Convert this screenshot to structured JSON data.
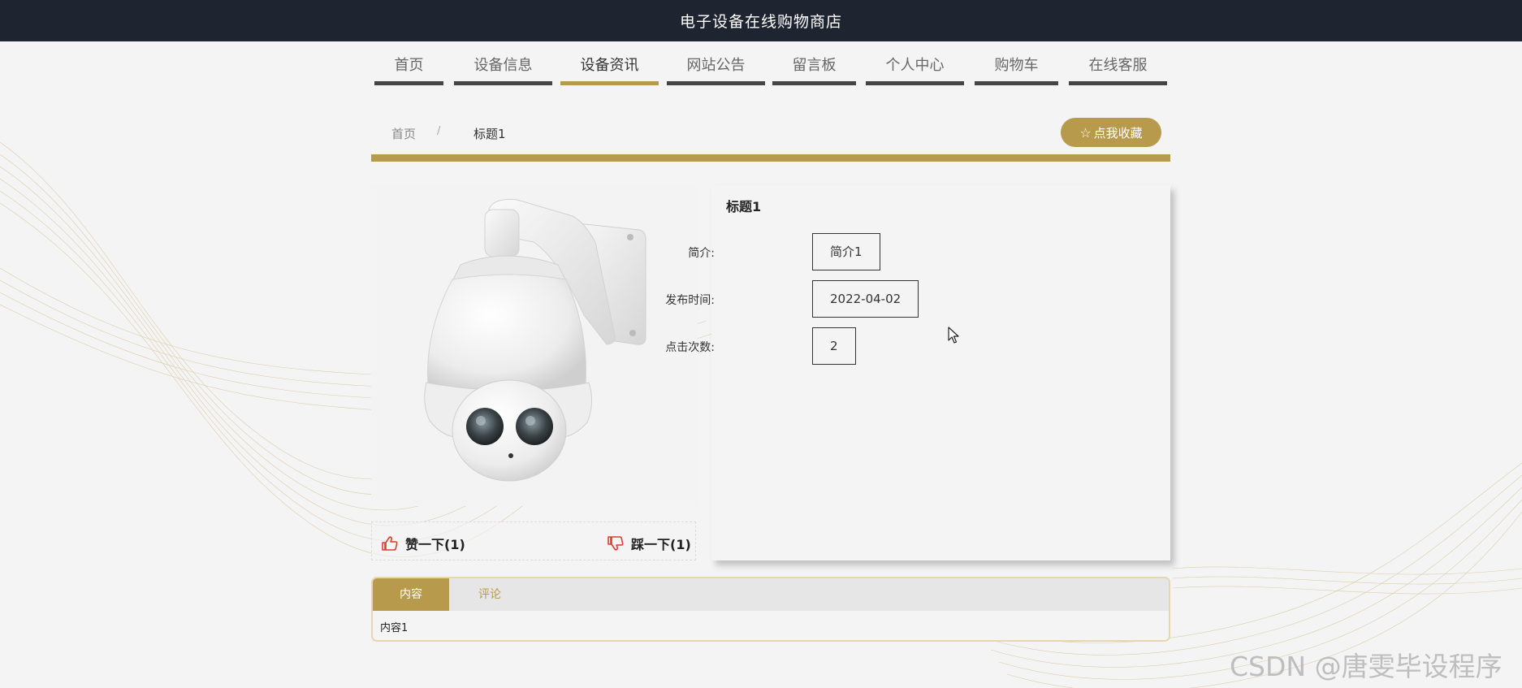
{
  "header": {
    "title": "电子设备在线购物商店"
  },
  "nav": {
    "items": [
      {
        "label": "首页"
      },
      {
        "label": "设备信息"
      },
      {
        "label": "设备资讯",
        "active": true
      },
      {
        "label": "网站公告"
      },
      {
        "label": "留言板"
      },
      {
        "label": "个人中心"
      },
      {
        "label": "购物车"
      },
      {
        "label": "在线客服"
      }
    ]
  },
  "breadcrumb": {
    "home": "首页",
    "separator": "/",
    "current": "标题1"
  },
  "favorite": {
    "icon": "star-outline-icon",
    "label": "点我收藏"
  },
  "detail": {
    "title": "标题1",
    "fields": [
      {
        "label": "简介:",
        "value": "简介1"
      },
      {
        "label": "发布时间:",
        "value": "2022-04-02"
      },
      {
        "label": "点击次数:",
        "value": "2"
      }
    ]
  },
  "votes": {
    "like": {
      "icon": "thumbs-up-icon",
      "label": "赞一下(1)"
    },
    "dislike": {
      "icon": "thumbs-down-icon",
      "label": "踩一下(1)"
    }
  },
  "tabs": {
    "items": [
      {
        "label": "内容",
        "active": true
      },
      {
        "label": "评论"
      }
    ],
    "content": "内容1"
  },
  "watermark": "CSDN @唐雯毕设程序",
  "colors": {
    "accent": "#b89a4d",
    "topbar": "#1e2430",
    "nav_underline": "#444444",
    "vote_icon": "#e23b2e"
  }
}
